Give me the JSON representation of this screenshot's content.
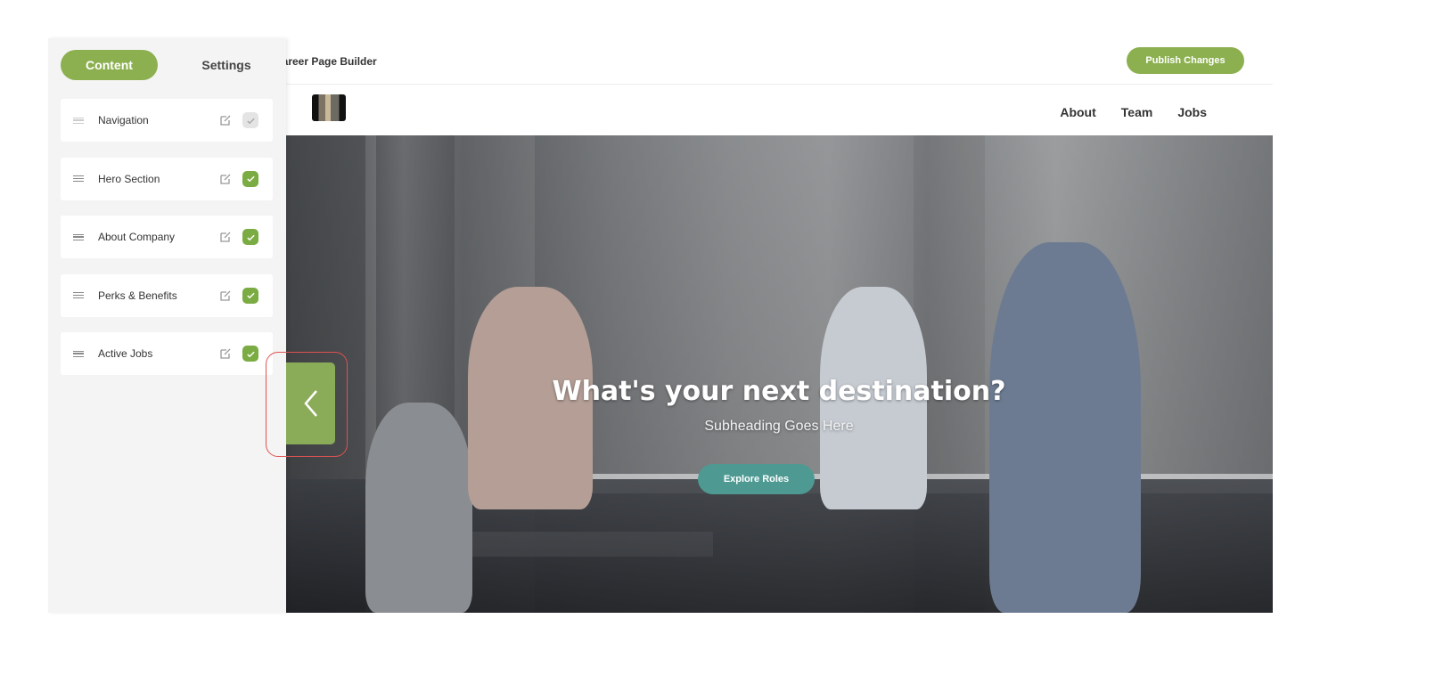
{
  "header": {
    "app_title": "Career Page Builder",
    "publish_label": "Publish Changes"
  },
  "sidebar": {
    "tabs": [
      {
        "label": "Content",
        "active": true
      },
      {
        "label": "Settings",
        "active": false
      }
    ],
    "sections": [
      {
        "label": "Navigation",
        "enabled": false,
        "edit_icon": "edit-icon"
      },
      {
        "label": "Hero Section",
        "enabled": true,
        "edit_icon": "edit-icon"
      },
      {
        "label": "About Company",
        "enabled": true,
        "edit_icon": "edit-icon"
      },
      {
        "label": "Perks & Benefits",
        "enabled": true,
        "edit_icon": "edit-icon"
      },
      {
        "label": "Active Jobs",
        "enabled": true,
        "edit_icon": "edit-icon"
      }
    ],
    "collapse_icon": "chevron-left-icon"
  },
  "preview": {
    "nav_links": [
      "About",
      "Team",
      "Jobs"
    ],
    "hero": {
      "title": "What's your next destination?",
      "subheading": "Subheading Goes Here",
      "cta_label": "Explore Roles"
    }
  },
  "colors": {
    "accent": "#8cb050",
    "check_on": "#7bab43",
    "check_off": "#e4e4e4",
    "cta": "#4e9a93",
    "highlight": "#e05252"
  }
}
